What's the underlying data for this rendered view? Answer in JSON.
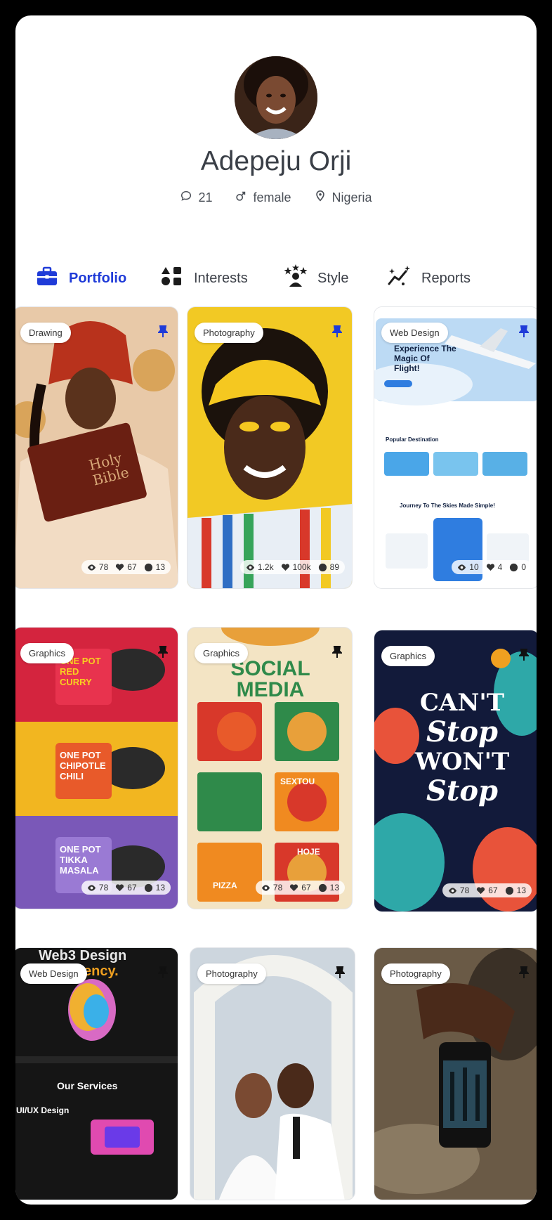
{
  "profile": {
    "name": "Adepeju Orji",
    "comments": "21",
    "gender": "female",
    "location": "Nigeria"
  },
  "tabs": [
    {
      "label": "Portfolio",
      "icon": "briefcase-icon",
      "active": true
    },
    {
      "label": "Interests",
      "icon": "shapes-icon",
      "active": false
    },
    {
      "label": "Style",
      "icon": "person-stars-icon",
      "active": false
    },
    {
      "label": "Reports",
      "icon": "chart-sparkle-icon",
      "active": false
    }
  ],
  "colors": {
    "accent": "#1f3bd8"
  },
  "cards": [
    {
      "tag": "Drawing",
      "views": "78",
      "likes": "67",
      "comments": "13",
      "art": {
        "line1": "Holy",
        "line2": "Bible"
      }
    },
    {
      "tag": "Photography",
      "views": "1.2k",
      "likes": "100k",
      "comments": "89"
    },
    {
      "tag": "Web Design",
      "views": "10",
      "likes": "4",
      "comments": "0",
      "art": {
        "headline": "Experience The Magic Of Flight!",
        "section": "Popular Destination",
        "journey": "Journey To The Skies Made Simple!"
      }
    },
    {
      "tag": "Graphics",
      "views": "78",
      "likes": "67",
      "comments": "13",
      "art": {
        "a": "ONE POT RED CURRY",
        "b": "ONE POT CHIPOTLE CHILI",
        "c": "ONE POT TIKKA MASALA"
      }
    },
    {
      "tag": "Graphics",
      "views": "78",
      "likes": "67",
      "comments": "13",
      "art": {
        "title": "SOCIAL MEDIA",
        "p1": "PIZZA",
        "p2": "SEXTOU",
        "p3": "HOJE"
      }
    },
    {
      "tag": "Graphics",
      "views": "78",
      "likes": "67",
      "comments": "13",
      "art": {
        "l1": "CAN'T",
        "l2": "Stop",
        "l3": "WON'T",
        "l4": "Stop"
      }
    },
    {
      "tag": "Web Design",
      "views": "",
      "likes": "",
      "comments": "",
      "art": {
        "title": "Web3 Design",
        "sub": "ency.",
        "services": "Our Services",
        "ux": "UI/UX Design"
      }
    },
    {
      "tag": "Photography",
      "views": "",
      "likes": "",
      "comments": "",
      "art": {}
    },
    {
      "tag": "Photography",
      "views": "",
      "likes": "",
      "comments": "",
      "art": {}
    }
  ]
}
